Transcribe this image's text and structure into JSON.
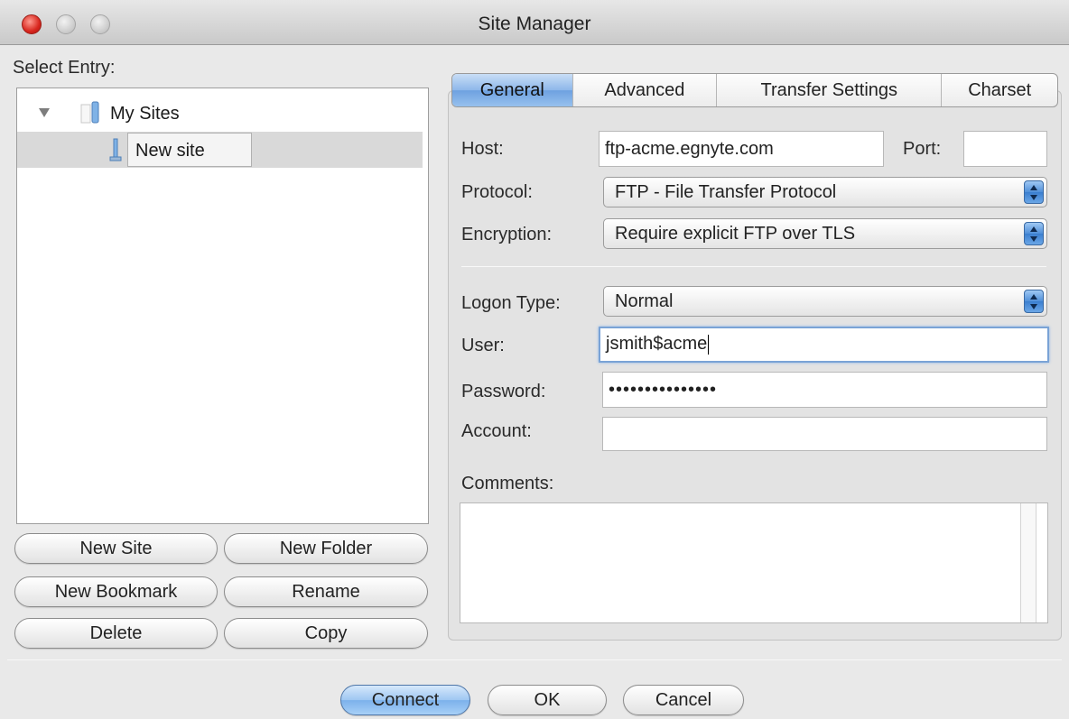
{
  "window": {
    "title": "Site Manager"
  },
  "left": {
    "select_entry_label": "Select Entry:",
    "tree": {
      "root_label": "My Sites",
      "child_label": "New site"
    },
    "buttons": {
      "new_site": "New Site",
      "new_folder": "New Folder",
      "new_bookmark": "New Bookmark",
      "rename": "Rename",
      "delete": "Delete",
      "copy": "Copy"
    }
  },
  "tabs": [
    {
      "label": "General",
      "active": true
    },
    {
      "label": "Advanced",
      "active": false
    },
    {
      "label": "Transfer Settings",
      "active": false
    },
    {
      "label": "Charset",
      "active": false
    }
  ],
  "general": {
    "host_label": "Host:",
    "host_value": "ftp-acme.egnyte.com",
    "port_label": "Port:",
    "port_value": "",
    "protocol_label": "Protocol:",
    "protocol_value": "FTP - File Transfer Protocol",
    "encryption_label": "Encryption:",
    "encryption_value": "Require explicit FTP over TLS",
    "logon_type_label": "Logon Type:",
    "logon_type_value": "Normal",
    "user_label": "User:",
    "user_value": "jsmith$acme",
    "password_label": "Password:",
    "password_value": "•••••••••••••••",
    "account_label": "Account:",
    "account_value": "",
    "comments_label": "Comments:",
    "comments_value": ""
  },
  "footer": {
    "connect": "Connect",
    "ok": "OK",
    "cancel": "Cancel"
  },
  "colors": {
    "accent": "#7cb1eb",
    "selection_row": "#d9d9d9",
    "close_button": "#d8261e"
  }
}
